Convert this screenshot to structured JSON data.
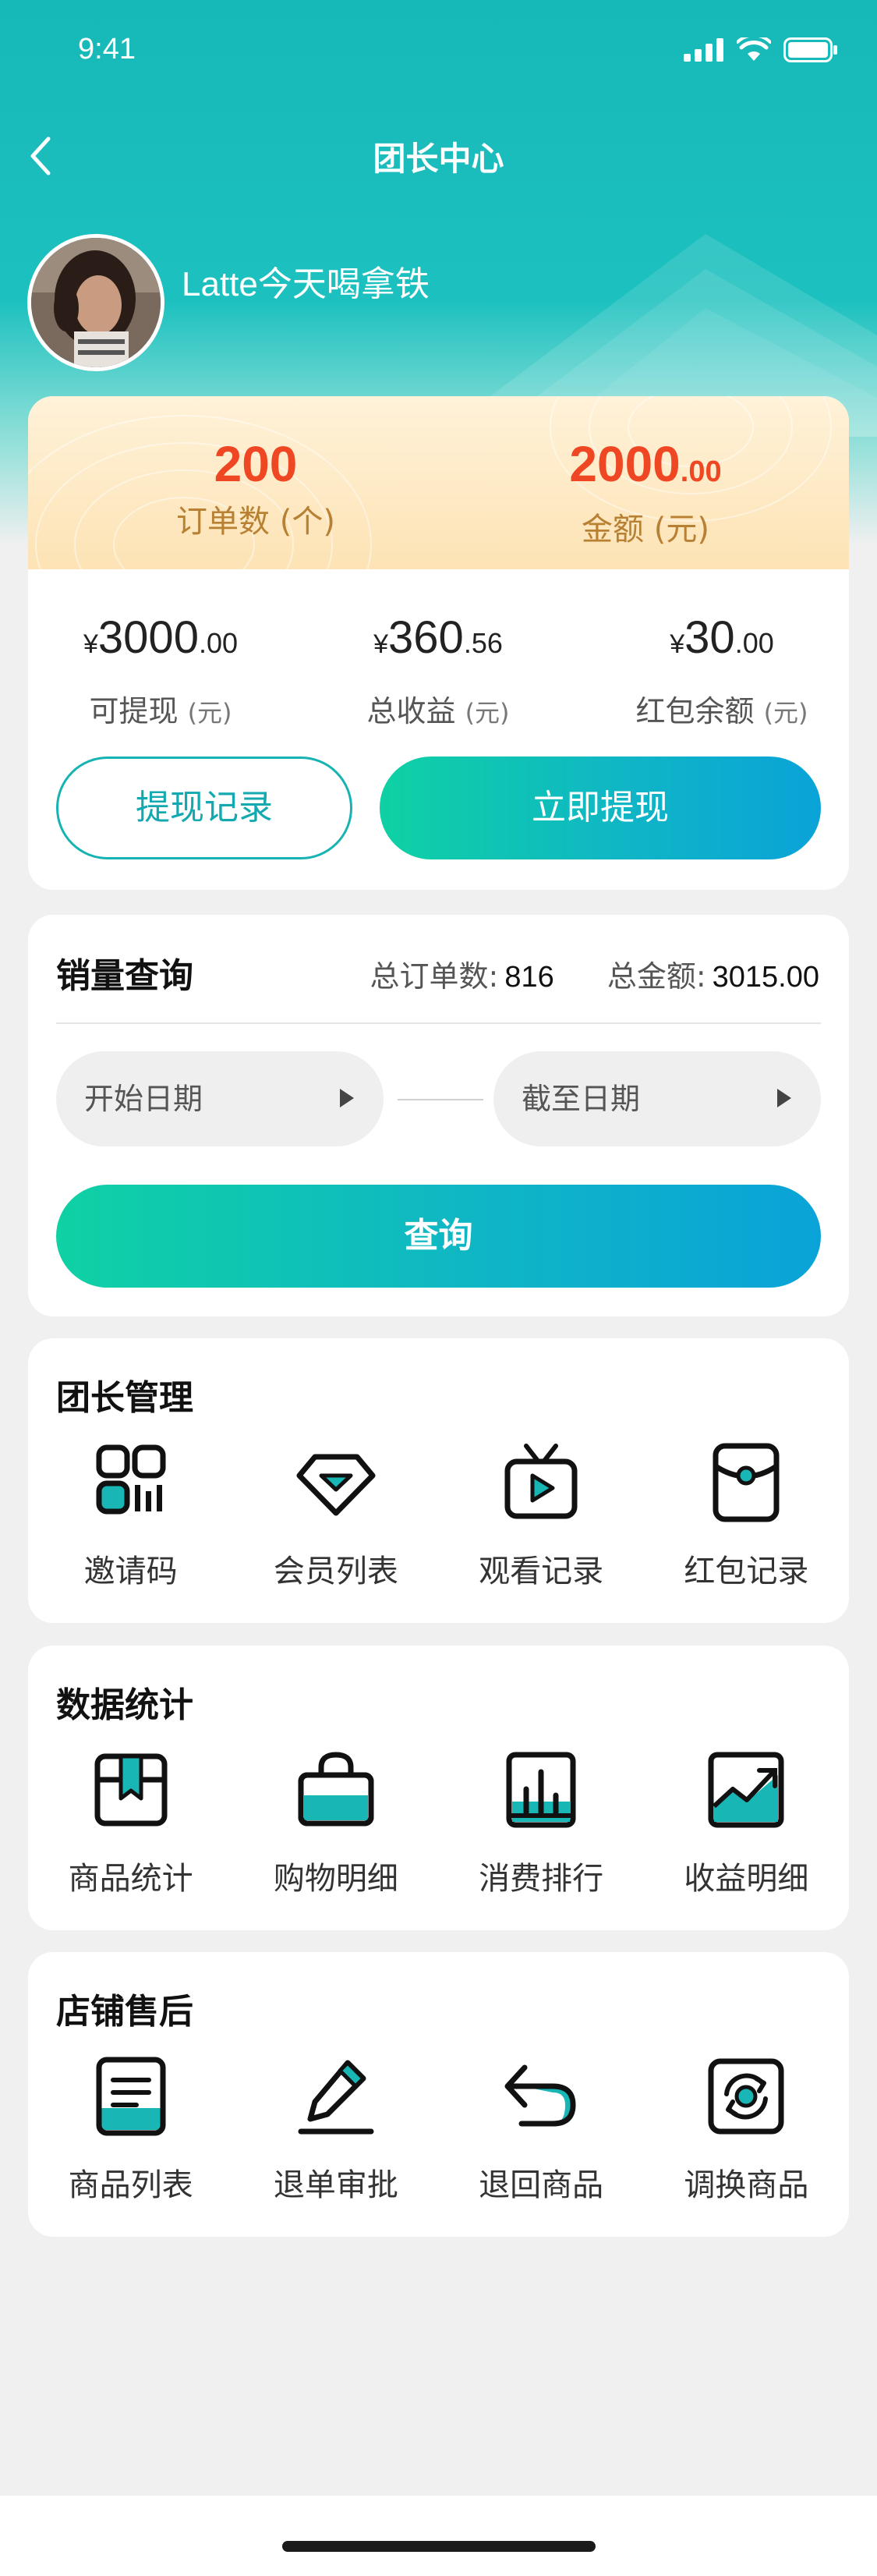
{
  "status_bar": {
    "time": "9:41"
  },
  "nav": {
    "title": "团长中心"
  },
  "profile": {
    "username": "Latte今天喝拿铁"
  },
  "wallet": {
    "orders": {
      "value": "200",
      "label": "订单数 (个)"
    },
    "amount": {
      "value_int": "2000",
      "value_dec": ".00",
      "label": "金额 (元)"
    },
    "withdrawable": {
      "yen": "¥",
      "int": "3000",
      "dec": ".00",
      "label": "可提现",
      "unit": "(元)"
    },
    "total_income": {
      "yen": "¥",
      "int": "360",
      "dec": ".56",
      "label": "总收益",
      "unit": "(元)"
    },
    "red_packet": {
      "yen": "¥",
      "int": "30",
      "dec": ".00",
      "label": "红包余额",
      "unit": "(元)"
    },
    "history_button": "提现记录",
    "withdraw_button": "立即提现"
  },
  "sales_query": {
    "title": "销量查询",
    "total_orders_label": "总订单数:",
    "total_orders_value": "816",
    "total_amount_label": "总金额:",
    "total_amount_value": "3015.00",
    "start_date_placeholder": "开始日期",
    "end_date_placeholder": "截至日期",
    "query_button": "查询"
  },
  "leader_management": {
    "title": "团长管理",
    "items": [
      {
        "label": "邀请码",
        "icon": "qr-code-icon"
      },
      {
        "label": "会员列表",
        "icon": "diamond-icon"
      },
      {
        "label": "观看记录",
        "icon": "tv-play-icon"
      },
      {
        "label": "红包记录",
        "icon": "red-envelope-icon"
      }
    ]
  },
  "data_statistics": {
    "title": "数据统计",
    "items": [
      {
        "label": "商品统计",
        "icon": "box-icon"
      },
      {
        "label": "购物明细",
        "icon": "shopping-bag-icon"
      },
      {
        "label": "消费排行",
        "icon": "bar-chart-icon"
      },
      {
        "label": "收益明细",
        "icon": "trend-chart-icon"
      }
    ]
  },
  "after_sales": {
    "title": "店铺售后",
    "items": [
      {
        "label": "商品列表",
        "icon": "list-document-icon"
      },
      {
        "label": "退单审批",
        "icon": "pencil-icon"
      },
      {
        "label": "退回商品",
        "icon": "return-arrow-icon"
      },
      {
        "label": "调换商品",
        "icon": "exchange-icon"
      }
    ]
  },
  "colors": {
    "accent": "#17b8b8",
    "highlight": "#ef4623",
    "gradient_start": "#0fd1a4",
    "gradient_end": "#0aa3d8"
  }
}
